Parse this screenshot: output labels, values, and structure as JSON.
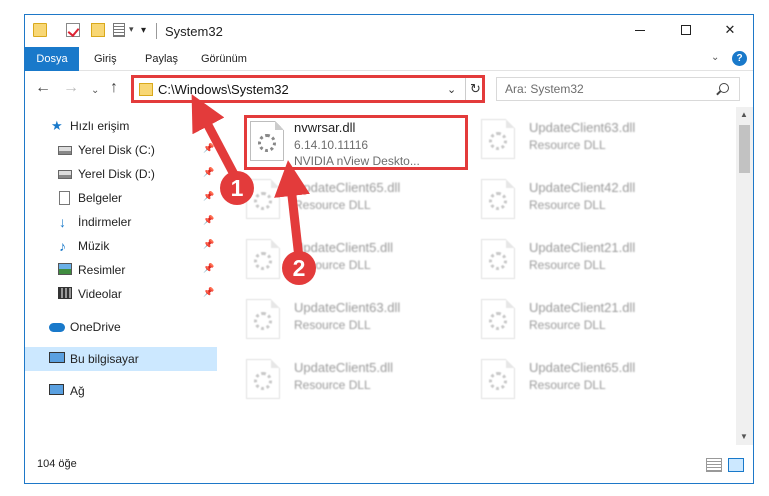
{
  "window": {
    "title": "System32",
    "controls": {
      "minimize": "minimize-icon",
      "maximize": "maximize-icon",
      "close": "✕"
    }
  },
  "ribbon": {
    "tabs": [
      "Dosya",
      "Giriş",
      "Paylaş",
      "Görünüm"
    ],
    "expand": "⌄",
    "help": "?"
  },
  "nav": {
    "back": "←",
    "forward": "→",
    "recent": "⌄",
    "up": "↑",
    "address": "C:\\Windows\\System32",
    "address_drop": "⌄",
    "refresh": "↻",
    "search_placeholder": "Ara: System32"
  },
  "sidebar": {
    "items": [
      {
        "label": "Hızlı erişim",
        "icon": "star-icon",
        "pinned": false
      },
      {
        "label": "Yerel Disk (C:)",
        "icon": "disk-icon",
        "pinned": true
      },
      {
        "label": "Yerel Disk (D:)",
        "icon": "disk-icon",
        "pinned": true
      },
      {
        "label": "Belgeler",
        "icon": "document-icon",
        "pinned": true
      },
      {
        "label": "İndirmeler",
        "icon": "download-icon",
        "pinned": true
      },
      {
        "label": "Müzik",
        "icon": "music-icon",
        "pinned": true
      },
      {
        "label": "Resimler",
        "icon": "pictures-icon",
        "pinned": true
      },
      {
        "label": "Videolar",
        "icon": "video-icon",
        "pinned": true
      },
      {
        "label": "OneDrive",
        "icon": "cloud-icon",
        "pinned": false
      },
      {
        "label": "Bu bilgisayar",
        "icon": "computer-icon",
        "pinned": false,
        "selected": true
      },
      {
        "label": "Ağ",
        "icon": "network-icon",
        "pinned": false
      }
    ],
    "pin_glyph": "📌"
  },
  "files": {
    "main": {
      "name": "nvwrsar.dll",
      "version": "6.14.10.11116",
      "description": "NVIDIA nView Deskto..."
    },
    "background": [
      {
        "name": "UpdateClient63.dll",
        "type": "Resource DLL"
      },
      {
        "name": "UpdateClient65.dll",
        "type": "Resource DLL"
      },
      {
        "name": "UpdateClient42.dll",
        "type": "Resource DLL"
      },
      {
        "name": "UpdateClient5.dll",
        "type": "Resource DLL"
      },
      {
        "name": "UpdateClient21.dll",
        "type": "Resource DLL"
      },
      {
        "name": "UpdateClient63.dll",
        "type": "Resource DLL"
      },
      {
        "name": "UpdateClient21.dll",
        "type": "Resource DLL"
      },
      {
        "name": "UpdateClient5.dll",
        "type": "Resource DLL"
      },
      {
        "name": "UpdateClient65.dll",
        "type": "Resource DLL"
      }
    ]
  },
  "status": {
    "count": "104 öğe"
  },
  "annotations": {
    "step1": "1",
    "step2": "2",
    "color": "#e33b3b"
  }
}
